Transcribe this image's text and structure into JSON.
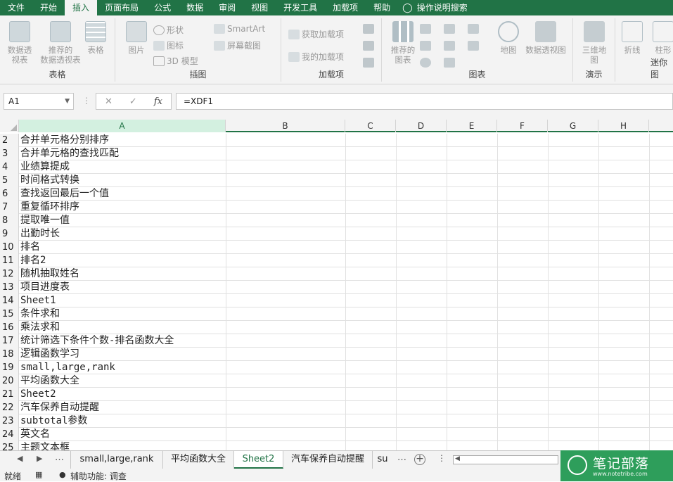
{
  "menu": {
    "tabs": [
      "文件",
      "开始",
      "插入",
      "页面布局",
      "公式",
      "数据",
      "审阅",
      "视图",
      "开发工具",
      "加载项",
      "帮助"
    ],
    "active_index": 2,
    "tell_me": "操作说明搜索"
  },
  "ribbon": {
    "groups": {
      "tables": {
        "label": "表格",
        "buttons": [
          "数据透\n视表",
          "推荐的\n数据透视表",
          "表格"
        ]
      },
      "illustrations": {
        "label": "插图",
        "picture": "图片",
        "shapes": "形状",
        "icons": "图标",
        "models3d": "3D 模型",
        "smartart": "SmartArt",
        "screenshot": "屏幕截图"
      },
      "addins": {
        "label": "加载项",
        "get": "获取加载项",
        "mine": "我的加载项"
      },
      "charts": {
        "label": "图表",
        "recommended": "推荐的\n图表",
        "map": "地图",
        "pivotchart": "数据透视图"
      },
      "tours": {
        "label": "演示",
        "map3d": "三维地\n图"
      },
      "sparklines": {
        "label": "迷你图",
        "line": "折线",
        "column": "柱形"
      }
    }
  },
  "formula": {
    "namebox": "A1",
    "content": "=XDF1"
  },
  "columns": [
    "A",
    "B",
    "C",
    "D",
    "E",
    "F",
    "G",
    "H"
  ],
  "rows": [
    {
      "n": "2",
      "a": "合并单元格分别排序"
    },
    {
      "n": "3",
      "a": "合并单元格的查找匹配"
    },
    {
      "n": "4",
      "a": "业绩算提成"
    },
    {
      "n": "5",
      "a": "时间格式转换"
    },
    {
      "n": "6",
      "a": "查找返回最后一个值"
    },
    {
      "n": "7",
      "a": "重复循环排序"
    },
    {
      "n": "8",
      "a": "提取唯一值"
    },
    {
      "n": "9",
      "a": "出勤时长"
    },
    {
      "n": "10",
      "a": "排名"
    },
    {
      "n": "11",
      "a": "排名2"
    },
    {
      "n": "12",
      "a": "随机抽取姓名"
    },
    {
      "n": "13",
      "a": "项目进度表"
    },
    {
      "n": "14",
      "a": "Sheet1"
    },
    {
      "n": "15",
      "a": "条件求和"
    },
    {
      "n": "16",
      "a": "乘法求和"
    },
    {
      "n": "17",
      "a": "统计筛选下条件个数-排名函数大全"
    },
    {
      "n": "18",
      "a": "逻辑函数学习"
    },
    {
      "n": "19",
      "a": "small,large,rank"
    },
    {
      "n": "20",
      "a": "平均函数大全"
    },
    {
      "n": "21",
      "a": "Sheet2"
    },
    {
      "n": "22",
      "a": "汽车保养自动提醒"
    },
    {
      "n": "23",
      "a": "subtotal参数"
    },
    {
      "n": "24",
      "a": "英文名"
    },
    {
      "n": "25",
      "a": "主题文本框"
    }
  ],
  "sheet_tabs": [
    "small,large,rank",
    "平均函数大全",
    "Sheet2",
    "汽车保养自动提醒",
    "su"
  ],
  "active_sheet_index": 2,
  "status": {
    "ready": "就绪",
    "accessibility": "辅助功能: 调查"
  },
  "watermark": {
    "title": "笔记部落",
    "url": "www.notetribe.com"
  },
  "colors": {
    "accent": "#217346",
    "ribbon_bg": "#f3f3f3"
  }
}
